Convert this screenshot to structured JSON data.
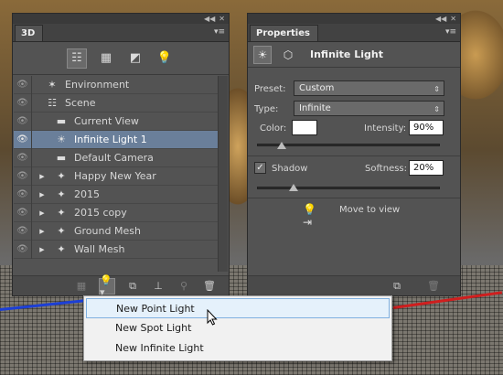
{
  "colors": {
    "selection": "#6a7f9a",
    "panel": "#535353",
    "dropdown_highlight": "#e5f1fb"
  },
  "panel3d": {
    "tab": "3D",
    "filter_icons": [
      "scene-filter-icon",
      "mesh-filter-icon",
      "material-filter-icon",
      "light-filter-icon"
    ],
    "layers": [
      {
        "label": "Environment",
        "icon": "environment-icon",
        "expand": false,
        "sel": false
      },
      {
        "label": "Scene",
        "icon": "scene-icon",
        "expand": false,
        "sel": false
      },
      {
        "label": "Current View",
        "icon": "camera-icon",
        "expand": false,
        "sel": false
      },
      {
        "label": "Infinite Light 1",
        "icon": "infinite-light-icon",
        "expand": false,
        "sel": true
      },
      {
        "label": "Default Camera",
        "icon": "camera-icon",
        "expand": false,
        "sel": false
      },
      {
        "label": "Happy New Year",
        "icon": "mesh-icon",
        "expand": true,
        "sel": false
      },
      {
        "label": "2015",
        "icon": "mesh-icon",
        "expand": true,
        "sel": false
      },
      {
        "label": "2015 copy",
        "icon": "mesh-icon",
        "expand": true,
        "sel": false
      },
      {
        "label": "Ground Mesh",
        "icon": "mesh-icon",
        "expand": true,
        "sel": false
      },
      {
        "label": "Wall Mesh",
        "icon": "mesh-icon",
        "expand": true,
        "sel": false
      }
    ]
  },
  "props": {
    "tab": "Properties",
    "title": "Infinite Light",
    "preset_label": "Preset:",
    "preset_value": "Custom",
    "type_label": "Type:",
    "type_value": "Infinite",
    "color_label": "Color:",
    "intensity_label": "Intensity:",
    "intensity_value": "90%",
    "shadow_label": "Shadow",
    "shadow_checked": true,
    "softness_label": "Softness:",
    "softness_value": "20%",
    "move_label": "Move to view"
  },
  "dropdown": {
    "items": [
      "New Point Light",
      "New Spot Light",
      "New Infinite Light"
    ],
    "highlighted": 0
  }
}
